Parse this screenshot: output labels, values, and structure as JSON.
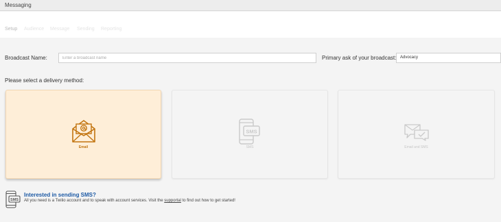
{
  "header": {
    "title": "Messaging"
  },
  "steps": [
    {
      "label": "Setup",
      "active": true
    },
    {
      "label": "Audience",
      "active": false
    },
    {
      "label": "Message",
      "active": false
    },
    {
      "label": "Sending",
      "active": false
    },
    {
      "label": "Reporting",
      "active": false
    }
  ],
  "form": {
    "broadcast_name_label": "Broadcast Name:",
    "broadcast_name_placeholder": "Enter a broadcast name",
    "primary_ask_label": "Primary ask of your broadcast:",
    "primary_ask_value": "Advocacy"
  },
  "delivery": {
    "prompt": "Please select a delivery method:",
    "options": [
      {
        "label": "Email",
        "icon": "email-envelope-icon",
        "selected": true
      },
      {
        "label": "SMS",
        "icon": "phone-sms-icon",
        "selected": false
      },
      {
        "label": "Email and SMS",
        "icon": "chat-bubbles-icon",
        "selected": false
      }
    ]
  },
  "sms_note": {
    "title": "Interested in sending SMS?",
    "text_before": "All you need is a Twilio account and to speak with account services. Visit the ",
    "link": "supportal",
    "text_after": " to find out how to get started!"
  },
  "colors": {
    "selected_bg": "#feeed8",
    "accent": "#c2740f",
    "link_blue": "#1d5aa5"
  }
}
